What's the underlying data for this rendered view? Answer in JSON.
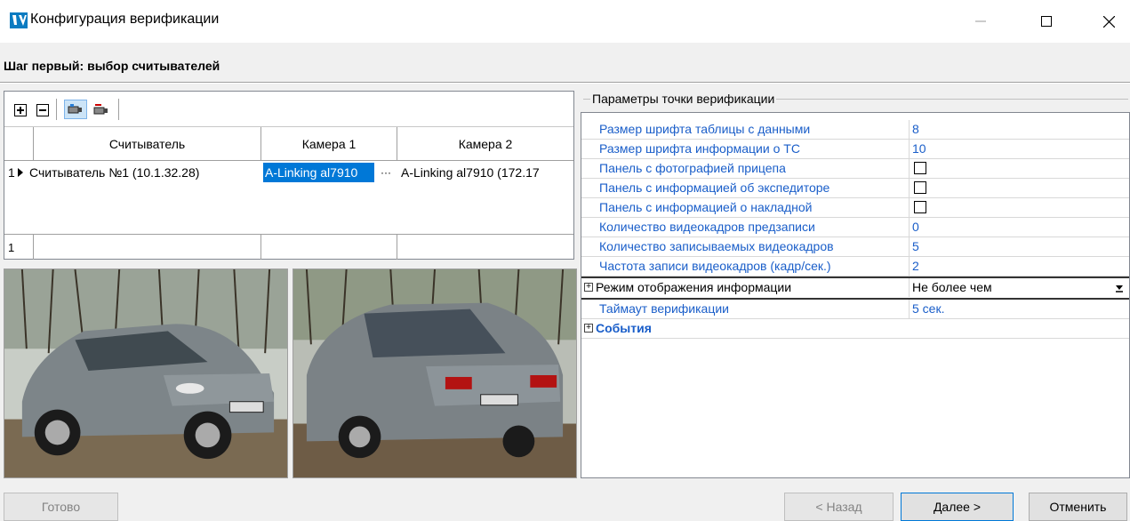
{
  "window": {
    "title": "Конфигурация верификации",
    "minimize_glyph": "—",
    "maximize_glyph": "☐",
    "close_glyph": "✕"
  },
  "step": {
    "title": "Шаг первый: выбор считывателей"
  },
  "toolbar": {
    "buttons": [
      "add-icon",
      "remove-icon",
      "camera-icon",
      "camera-remove-icon"
    ]
  },
  "grid": {
    "columns": [
      "Считыватель",
      "Камера 1",
      "Камера 2"
    ],
    "rows": [
      {
        "num": "1",
        "reader": "Считыватель №1 (10.1.32.28)",
        "camera1": "A-Linking al7910",
        "camera2": "A-Linking al7910 (172.17"
      }
    ],
    "footer_count": "1",
    "ellipsis": "···"
  },
  "properties": {
    "group_title": "Параметры точки верификации",
    "rows": [
      {
        "name": "Размер шрифта таблицы с данными",
        "value": "8",
        "type": "text"
      },
      {
        "name": "Размер шрифта информации о ТС",
        "value": "10",
        "type": "text"
      },
      {
        "name": "Панель с фотографией прицепа",
        "value": "",
        "type": "checkbox"
      },
      {
        "name": "Панель с информацией об экспедиторе",
        "value": "",
        "type": "checkbox"
      },
      {
        "name": "Панель с информацией о накладной",
        "value": "",
        "type": "checkbox"
      },
      {
        "name": "Количество видеокадров предзаписи",
        "value": "0",
        "type": "text"
      },
      {
        "name": "Количество записываемых видеокадров",
        "value": "5",
        "type": "text"
      },
      {
        "name": "Частота записи видеокадров (кадр/сек.)",
        "value": "2",
        "type": "text"
      },
      {
        "name": "Режим отображения информации",
        "value": "Не более чем",
        "type": "dropdown"
      },
      {
        "name": "Таймаут верификации",
        "value": "5 сек.",
        "type": "text"
      },
      {
        "name": "События",
        "value": "",
        "type": "category"
      }
    ]
  },
  "buttons": {
    "done": "Готово",
    "back": "< Назад",
    "next": "Далее >",
    "cancel": "Отменить"
  },
  "colors": {
    "accent": "#0078d7",
    "property_text": "#1a5ec9",
    "app_icon": "#0b7bc1"
  }
}
